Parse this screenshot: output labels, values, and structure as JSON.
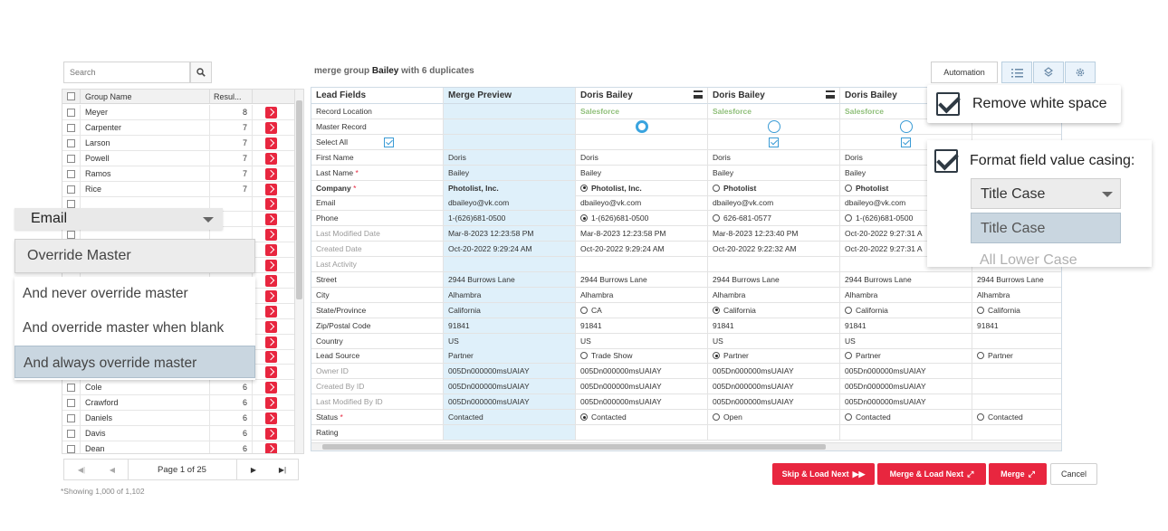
{
  "search": {
    "placeholder": "Search"
  },
  "left_table": {
    "headers": {
      "group": "Group Name",
      "results": "Resul..."
    },
    "rows": [
      {
        "name": "Meyer",
        "count": "8"
      },
      {
        "name": "Carpenter",
        "count": "7"
      },
      {
        "name": "Larson",
        "count": "7"
      },
      {
        "name": "Powell",
        "count": "7"
      },
      {
        "name": "Ramos",
        "count": "7"
      },
      {
        "name": "Rice",
        "count": "7"
      },
      {
        "name": "",
        "count": ""
      },
      {
        "name": "",
        "count": ""
      },
      {
        "name": "",
        "count": ""
      },
      {
        "name": "",
        "count": ""
      },
      {
        "name": "",
        "count": ""
      },
      {
        "name": "",
        "count": ""
      },
      {
        "name": "",
        "count": ""
      },
      {
        "name": "",
        "count": ""
      },
      {
        "name": "",
        "count": ""
      },
      {
        "name": "",
        "count": ""
      },
      {
        "name": "",
        "count": ""
      },
      {
        "name": "",
        "count": ""
      },
      {
        "name": "Cole",
        "count": "6"
      },
      {
        "name": "Crawford",
        "count": "6"
      },
      {
        "name": "Daniels",
        "count": "6"
      },
      {
        "name": "Davis",
        "count": "6"
      },
      {
        "name": "Dean",
        "count": "6"
      }
    ]
  },
  "pager": {
    "label": "Page 1 of 25",
    "showing": "*Showing 1,000 of 1,102"
  },
  "merge_group": {
    "prefix": "merge group",
    "name": "Bailey",
    "suffix": "with 6 duplicates"
  },
  "toolbar": {
    "automation": "Automation"
  },
  "grid": {
    "columns": [
      "Lead Fields",
      "Merge Preview",
      "Doris Bailey",
      "Doris Bailey",
      "Doris Bailey",
      ""
    ],
    "record_location": [
      "Salesforce",
      "Salesforce",
      "Salesforce"
    ],
    "rows": [
      {
        "field": "Record Location",
        "grey": false,
        "bold": false,
        "req": false,
        "preview": "",
        "vals": [
          "",
          "",
          "",
          ""
        ]
      },
      {
        "field": "Master Record",
        "grey": false,
        "bold": false,
        "req": false,
        "preview": "",
        "vals": [
          "",
          "",
          "",
          ""
        ]
      },
      {
        "field": "Select All",
        "grey": false,
        "bold": false,
        "req": false,
        "preview": "",
        "vals": [
          "",
          "",
          "",
          ""
        ]
      },
      {
        "field": "First Name",
        "grey": false,
        "bold": false,
        "req": false,
        "preview": "Doris",
        "vals": [
          "Doris",
          "Doris",
          "Doris",
          ""
        ]
      },
      {
        "field": "Last Name",
        "grey": false,
        "bold": false,
        "req": true,
        "preview": "Bailey",
        "vals": [
          "Bailey",
          "Bailey",
          "Bailey",
          ""
        ]
      },
      {
        "field": "Company",
        "grey": false,
        "bold": true,
        "req": true,
        "preview": "Photolist, Inc.",
        "vals": [
          "Photolist, Inc.",
          "Photolist",
          "Photolist",
          ""
        ],
        "radios": [
          1,
          0,
          0
        ]
      },
      {
        "field": "Email",
        "grey": false,
        "bold": false,
        "req": false,
        "preview": "dbaileyo@vk.com",
        "vals": [
          "dbaileyo@vk.com",
          "dbaileyo@vk.com",
          "dbaileyo@vk.com",
          ""
        ]
      },
      {
        "field": "Phone",
        "grey": false,
        "bold": false,
        "req": false,
        "preview": "1-(626)681-0500",
        "vals": [
          "1-(626)681-0500",
          "626-681-0577",
          "1-(626)681-0500",
          ""
        ],
        "radios": [
          1,
          0,
          0
        ]
      },
      {
        "field": "Last Modified Date",
        "grey": true,
        "bold": false,
        "req": false,
        "preview": "Mar-8-2023 12:23:58 PM",
        "vals": [
          "Mar-8-2023 12:23:58 PM",
          "Mar-8-2023 12:23:40 PM",
          "Oct-20-2022 9:27:31 A",
          ""
        ]
      },
      {
        "field": "Created Date",
        "grey": true,
        "bold": false,
        "req": false,
        "preview": "Oct-20-2022 9:29:24 AM",
        "vals": [
          "Oct-20-2022 9:29:24 AM",
          "Oct-20-2022 9:22:32 AM",
          "Oct-20-2022 9:27:31 A",
          ""
        ]
      },
      {
        "field": "Last Activity",
        "grey": true,
        "bold": false,
        "req": false,
        "preview": "",
        "vals": [
          "",
          "",
          "",
          ""
        ]
      },
      {
        "field": "Street",
        "grey": false,
        "bold": false,
        "req": false,
        "preview": "2944 Burrows Lane",
        "vals": [
          "2944 Burrows Lane",
          "2944 Burrows Lane",
          "2944 Burrows Lane",
          "2944 Burrows Lane"
        ]
      },
      {
        "field": "City",
        "grey": false,
        "bold": false,
        "req": false,
        "preview": "Alhambra",
        "vals": [
          "Alhambra",
          "Alhambra",
          "Alhambra",
          "Alhambra"
        ]
      },
      {
        "field": "State/Province",
        "grey": false,
        "bold": false,
        "req": false,
        "preview": "California",
        "vals": [
          "CA",
          "California",
          "California",
          "California"
        ],
        "radios": [
          0,
          1,
          0,
          0
        ]
      },
      {
        "field": "Zip/Postal Code",
        "grey": false,
        "bold": false,
        "req": false,
        "preview": "91841",
        "vals": [
          "91841",
          "91841",
          "91841",
          "91841"
        ]
      },
      {
        "field": "Country",
        "grey": false,
        "bold": false,
        "req": false,
        "preview": "US",
        "vals": [
          "US",
          "US",
          "US",
          ""
        ]
      },
      {
        "field": "Lead Source",
        "grey": false,
        "bold": false,
        "req": false,
        "preview": "Partner",
        "vals": [
          "Trade Show",
          "Partner",
          "Partner",
          "Partner"
        ],
        "radios": [
          0,
          1,
          0,
          0
        ]
      },
      {
        "field": "Owner ID",
        "grey": true,
        "bold": false,
        "req": false,
        "preview": "005Dn000000msUAIAY",
        "vals": [
          "005Dn000000msUAIAY",
          "005Dn000000msUAIAY",
          "005Dn000000msUAIAY",
          ""
        ]
      },
      {
        "field": "Created By ID",
        "grey": true,
        "bold": false,
        "req": false,
        "preview": "005Dn000000msUAIAY",
        "vals": [
          "005Dn000000msUAIAY",
          "005Dn000000msUAIAY",
          "005Dn000000msUAIAY",
          ""
        ]
      },
      {
        "field": "Last Modified By ID",
        "grey": true,
        "bold": false,
        "req": false,
        "preview": "005Dn000000msUAIAY",
        "vals": [
          "005Dn000000msUAIAY",
          "005Dn000000msUAIAY",
          "005Dn000000msUAIAY",
          ""
        ]
      },
      {
        "field": "Status",
        "grey": false,
        "bold": false,
        "req": true,
        "preview": "Contacted",
        "vals": [
          "Contacted",
          "Open",
          "Contacted",
          "Contacted"
        ],
        "radios": [
          1,
          0,
          0,
          0
        ]
      },
      {
        "field": "Rating",
        "grey": false,
        "bold": false,
        "req": false,
        "preview": "",
        "vals": [
          "",
          "",
          "",
          ""
        ]
      }
    ]
  },
  "buttons": {
    "skip_load_next": "Skip & Load Next",
    "merge_load_next": "Merge & Load Next",
    "merge": "Merge",
    "cancel": "Cancel"
  },
  "email_popover": {
    "field": "Email",
    "override": "Override Master",
    "options": [
      "And never override master",
      "And override master when blank",
      "And always override master"
    ],
    "selected_index": 2
  },
  "whitespace_popover": {
    "label": "Remove white space"
  },
  "casing_popover": {
    "label": "Format field value casing:",
    "selected": "Title Case",
    "options": [
      "Title Case",
      "All Lower Case"
    ]
  },
  "colors": {
    "accent_red": "#e8263f",
    "preview_blue": "#dff0fa",
    "salesforce_green": "#8fbf7a"
  },
  "icons": [
    "search-icon",
    "list-icon",
    "layers-icon",
    "gear-icon",
    "menu-icon",
    "arrow-right-icon",
    "check-icon"
  ]
}
